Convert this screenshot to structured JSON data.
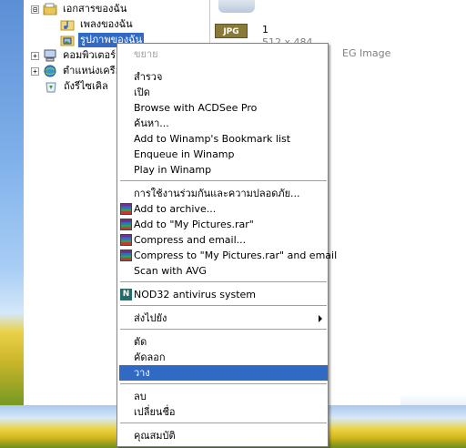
{
  "tree": {
    "items": [
      {
        "label": "เอกสารของฉัน",
        "expander": "⊟",
        "icon": "my-documents-icon"
      },
      {
        "label": "เพลงของฉัน",
        "expander": "",
        "icon": "my-music-icon"
      },
      {
        "label": "รูปภาพของฉัน",
        "expander": "",
        "icon": "my-pictures-icon",
        "selected": true
      },
      {
        "label": "คอมพิวเตอร์",
        "expander": "+",
        "icon": "my-computer-icon"
      },
      {
        "label": "ตำแหน่งเครือ",
        "expander": "+",
        "icon": "network-places-icon"
      },
      {
        "label": "ถังรีไซเคิล",
        "expander": "",
        "icon": "recycle-bin-icon"
      }
    ]
  },
  "file": {
    "badge": "JPG",
    "name": "1",
    "dimensions": "512 x 484",
    "type": "EG Image"
  },
  "menu": {
    "items": [
      {
        "label": "ขยาย",
        "disabled": true
      },
      {
        "label": "สำรวจ"
      },
      {
        "label": "เปิด"
      },
      {
        "label": "Browse with ACDSee Pro"
      },
      {
        "label": "ค้นหา..."
      },
      {
        "label": "Add to Winamp's Bookmark list"
      },
      {
        "label": "Enqueue in Winamp"
      },
      {
        "label": "Play in Winamp"
      },
      {
        "label": "การใช้งานร่วมกันและความปลอดภัย..."
      },
      {
        "label": "Add to archive...",
        "icon": "winrar-icon"
      },
      {
        "label": "Add to \"My Pictures.rar\"",
        "icon": "winrar-icon"
      },
      {
        "label": "Compress and email...",
        "icon": "winrar-icon"
      },
      {
        "label": "Compress to \"My Pictures.rar\" and email",
        "icon": "winrar-icon"
      },
      {
        "label": "Scan with AVG"
      },
      {
        "label": "NOD32 antivirus system",
        "icon": "nod32-icon",
        "icon_text": "N"
      },
      {
        "label": "ส่งไปยัง",
        "submenu": true
      },
      {
        "label": "ตัด"
      },
      {
        "label": "คัดลอก"
      },
      {
        "label": "วาง",
        "highlighted": true
      },
      {
        "label": "ลบ"
      },
      {
        "label": "เปลี่ยนชื่อ"
      },
      {
        "label": "คุณสมบัติ"
      }
    ]
  },
  "colors": {
    "highlight": "#316ac5",
    "disabled_text": "#a0a0a0"
  }
}
